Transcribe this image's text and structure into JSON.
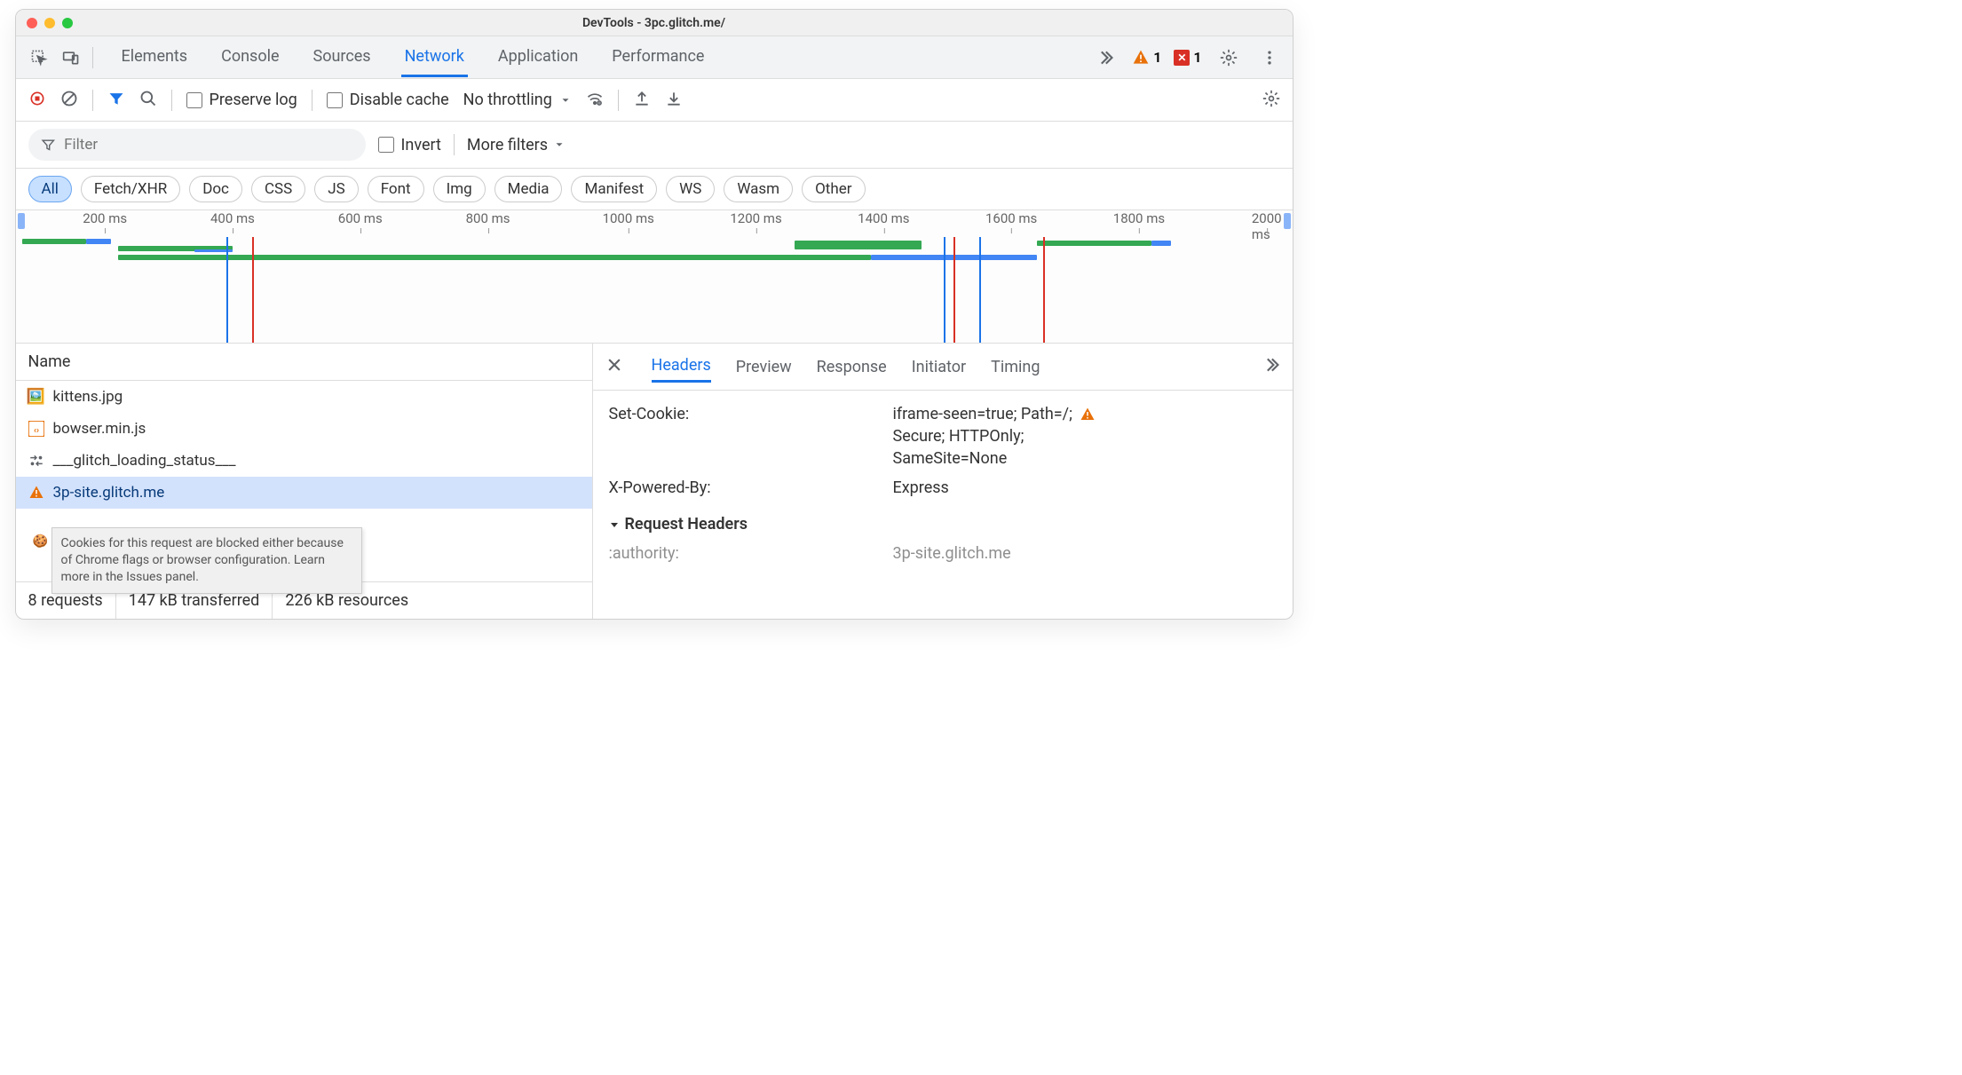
{
  "window": {
    "title": "DevTools - 3pc.glitch.me/"
  },
  "tabs": {
    "items": [
      "Elements",
      "Console",
      "Sources",
      "Network",
      "Application",
      "Performance"
    ],
    "active": "Network",
    "warn_count": "1",
    "err_count": "1"
  },
  "toolbar": {
    "preserve_log": "Preserve log",
    "disable_cache": "Disable cache",
    "throttle": "No throttling"
  },
  "filterbar": {
    "placeholder": "Filter",
    "invert": "Invert",
    "more": "More filters"
  },
  "types": {
    "all": "All",
    "items": [
      "Fetch/XHR",
      "Doc",
      "CSS",
      "JS",
      "Font",
      "Img",
      "Media",
      "Manifest",
      "WS",
      "Wasm",
      "Other"
    ]
  },
  "timeline": {
    "ticks": [
      "200 ms",
      "400 ms",
      "600 ms",
      "800 ms",
      "1000 ms",
      "1200 ms",
      "1400 ms",
      "1600 ms",
      "1800 ms",
      "2000 ms"
    ]
  },
  "requests": {
    "header": "Name",
    "rows": [
      {
        "icon": "img",
        "name": "kittens.jpg"
      },
      {
        "icon": "js",
        "name": "bowser.min.js"
      },
      {
        "icon": "xhr",
        "name": "___glitch_loading_status___"
      },
      {
        "icon": "warn",
        "name": "3p-site.glitch.me"
      }
    ],
    "tooltip": "Cookies for this request are blocked either because of Chrome flags or browser configuration. Learn more in the Issues panel."
  },
  "status": {
    "requests": "8 requests",
    "transferred": "147 kB transferred",
    "resources": "226 kB resources"
  },
  "detail": {
    "tabs": [
      "Headers",
      "Preview",
      "Response",
      "Initiator",
      "Timing"
    ],
    "active": "Headers",
    "set_cookie_key": "Set-Cookie:",
    "set_cookie_lines": [
      "iframe-seen=true; Path=/;",
      "Secure; HTTPOnly;",
      "SameSite=None"
    ],
    "xpb_key": "X-Powered-By:",
    "xpb_val": "Express",
    "req_hdr_title": "Request Headers",
    "authority_key": ":authority:",
    "authority_val": "3p-site.glitch.me"
  }
}
